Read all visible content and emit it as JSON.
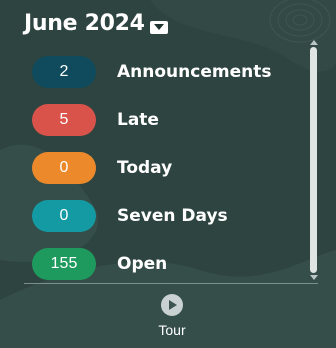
{
  "header": {
    "month": "June 2024",
    "dropdown_icon": "chevron-down-icon"
  },
  "summary": {
    "items": [
      {
        "count": "2",
        "label": "Announcements",
        "color": "#0f4b5c"
      },
      {
        "count": "5",
        "label": "Late",
        "color": "#d9534a"
      },
      {
        "count": "0",
        "label": "Today",
        "color": "#ec8a2b"
      },
      {
        "count": "0",
        "label": "Seven Days",
        "color": "#139aa2"
      },
      {
        "count": "155",
        "label": "Open",
        "color": "#1f9a5e"
      }
    ]
  },
  "footer": {
    "tour_label": "Tour",
    "tour_icon": "play-icon"
  },
  "colors": {
    "background": "#2e4440"
  }
}
